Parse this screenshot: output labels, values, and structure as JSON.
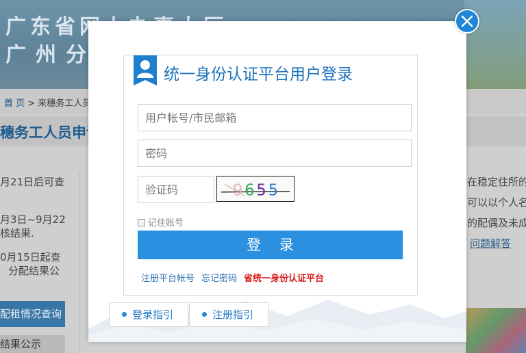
{
  "background": {
    "banner_line1": "广东省网上办事大厅",
    "banner_line2": "广州分厅",
    "breadcrumb_home": "首 页",
    "breadcrumb_rest": " > 来穗务工人员…",
    "heading": "穗务工人员申请…",
    "left_lines": [
      "月21日后可查",
      "月3日~9月22",
      "核结果.",
      "0月15日起查",
      "分配结果公"
    ],
    "left_button": "配租情况查询",
    "left_box": "结果公示",
    "right_lines": [
      "在稳定住所的手",
      "可以以个人名",
      "的配偶及未成"
    ],
    "right_link": "问题解答"
  },
  "modal": {
    "close_icon": "close-icon",
    "login": {
      "title": "统一身份认证平台用户登录",
      "user_icon": "user-icon",
      "username_placeholder": "用户帐号/市民邮箱",
      "password_placeholder": "密码",
      "captcha_placeholder": "验证码",
      "captcha_text": "9655",
      "remember_label": "记住账号",
      "login_button": "登 录",
      "link_register": "注册平台帐号",
      "link_forgot": "忘记密码",
      "link_platform": "省统一身份认证平台"
    },
    "guides": {
      "login_guide": "登录指引",
      "register_guide": "注册指引"
    }
  },
  "colors": {
    "accent_blue": "#2a90df",
    "title_blue": "#1d73bd",
    "link_red": "#d91a1a"
  }
}
